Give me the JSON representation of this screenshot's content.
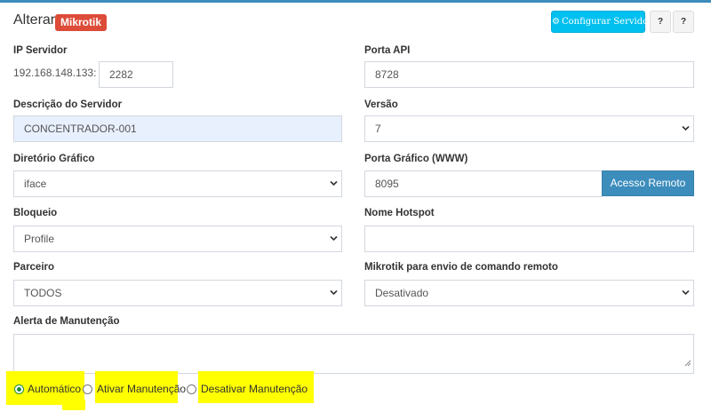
{
  "header": {
    "title": "Alterar",
    "badge": "Mikrotik",
    "config_button": "Configurar Servidor",
    "help_buttons": [
      "?",
      "?"
    ]
  },
  "fields": {
    "ip_servidor": {
      "label": "IP Servidor",
      "prefix": "192.168.148.133:",
      "value": "2282"
    },
    "porta_api": {
      "label": "Porta API",
      "value": "8728"
    },
    "descricao": {
      "label": "Descrição do Servidor",
      "value": "CONCENTRADOR-001"
    },
    "versao": {
      "label": "Versão",
      "value": "7"
    },
    "diretorio": {
      "label": "Diretório Gráfico",
      "value": "iface"
    },
    "porta_grafico": {
      "label": "Porta Gráfico (WWW)",
      "value": "8095",
      "button": "Acesso Remoto"
    },
    "bloqueio": {
      "label": "Bloqueio",
      "value": "Profile"
    },
    "nome_hotspot": {
      "label": "Nome Hotspot",
      "value": ""
    },
    "parceiro": {
      "label": "Parceiro",
      "value": "TODOS"
    },
    "mikrotik_remoto": {
      "label": "Mikrotik para envio de comando remoto",
      "value": "Desativado"
    },
    "alerta": {
      "label": "Alerta de Manutenção",
      "value": ""
    }
  },
  "radios": [
    {
      "label": "Automático",
      "checked": true
    },
    {
      "label": "Ativar Manutenção",
      "checked": false
    },
    {
      "label": "Desativar Manutenção",
      "checked": false
    }
  ],
  "colors": {
    "accent": "#3c8dbc",
    "badge": "#dd4b39",
    "config_button": "#00c0ef",
    "highlight": "#ffff00",
    "autofill": "#e8f0fe"
  },
  "icons": [
    "gear-icon",
    "chevron-down-icon",
    "resize-handle-icon"
  ]
}
